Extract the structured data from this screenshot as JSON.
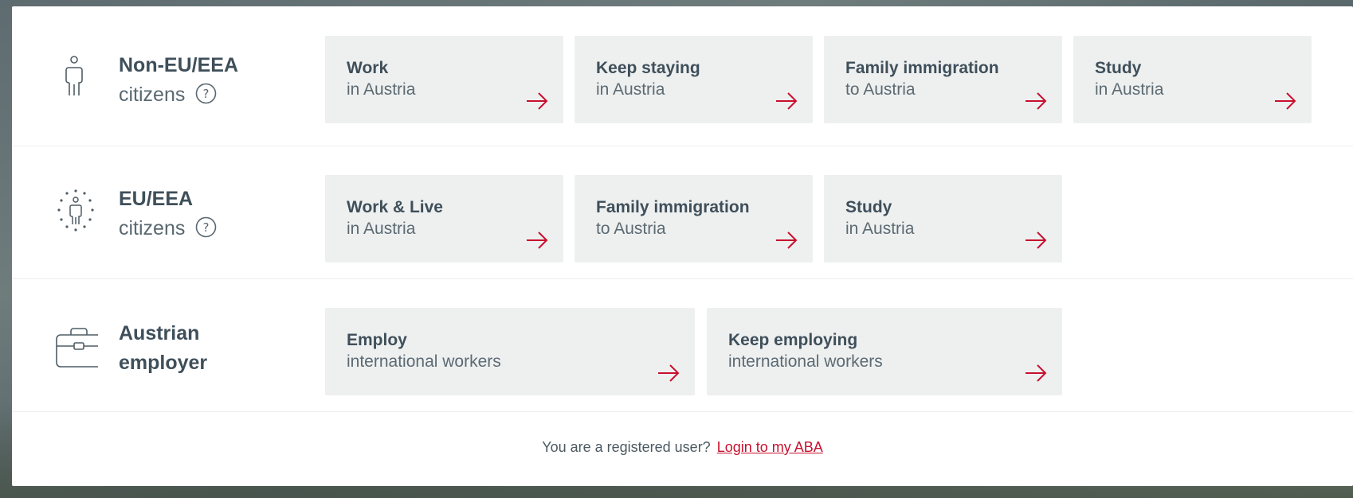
{
  "groups": {
    "non_eu": {
      "title_strong": "Non-EU/EEA",
      "title_weak": "citizens",
      "cards": [
        {
          "title": "Work",
          "sub": "in Austria"
        },
        {
          "title": "Keep staying",
          "sub": "in Austria"
        },
        {
          "title": "Family immigration",
          "sub": "to Austria"
        },
        {
          "title": "Study",
          "sub": "in Austria"
        }
      ]
    },
    "eu": {
      "title_strong": "EU/EEA",
      "title_weak": "citizens",
      "cards": [
        {
          "title": "Work & Live",
          "sub": "in Austria"
        },
        {
          "title": "Family immigration",
          "sub": "to Austria"
        },
        {
          "title": "Study",
          "sub": "in Austria"
        }
      ]
    },
    "employer": {
      "title_strong": "Austrian",
      "title_weak": "employer",
      "cards": [
        {
          "title": "Employ",
          "sub": "international workers"
        },
        {
          "title": "Keep employing",
          "sub": "international workers"
        }
      ]
    }
  },
  "footer": {
    "text": "You are a registered user?",
    "link": "Login to my ABA"
  },
  "icons": {
    "person": "person-icon",
    "eu_person": "eu-stars-person-icon",
    "briefcase": "briefcase-icon",
    "help": "help-circle-icon",
    "arrow": "arrow-right-icon"
  },
  "colors": {
    "accent": "#c8102e",
    "text": "#3f4f5a",
    "card_bg": "#eef0f0",
    "panel_bg": "#ffffff"
  }
}
